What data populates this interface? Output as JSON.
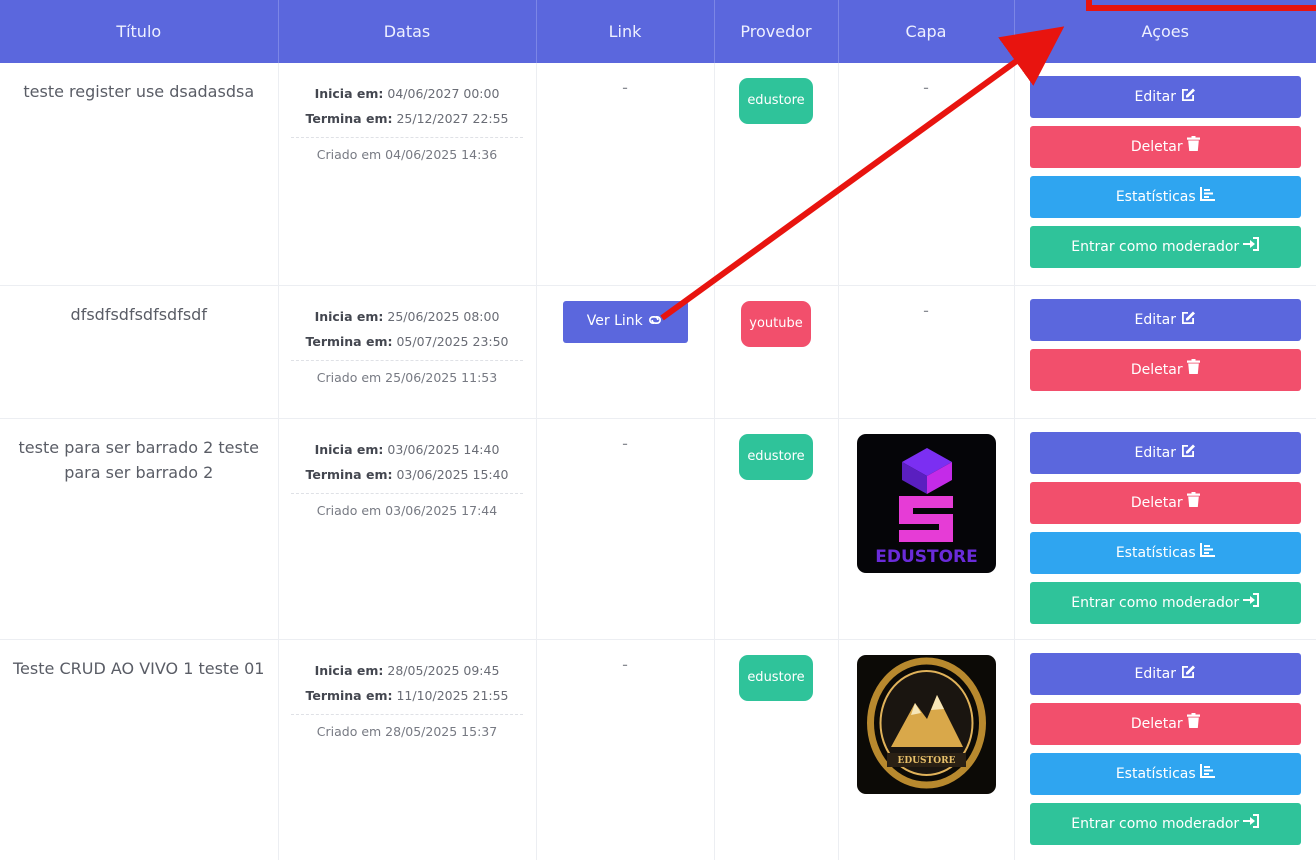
{
  "headers": [
    "Título",
    "Datas",
    "Link",
    "Provedor",
    "Capa",
    "Açoes"
  ],
  "labels": {
    "starts": "Inicia em:",
    "ends": "Termina em:",
    "dash": "-",
    "view_link": "Ver Link",
    "edit": "Editar",
    "delete": "Deletar",
    "stats": "Estatísticas",
    "moderator": "Entrar como moderador"
  },
  "rows": [
    {
      "title": "teste register use dsadasdsa",
      "starts": "04/06/2027 00:00",
      "ends": "25/12/2027 22:55",
      "created": "Criado em 04/06/2025 14:36",
      "provider": "edustore"
    },
    {
      "title": "dfsdfsdfsdfsdfsdf",
      "starts": "25/06/2025 08:00",
      "ends": "05/07/2025 23:50",
      "created": "Criado em 25/06/2025 11:53",
      "provider": "youtube"
    },
    {
      "title": "teste para ser barrado 2 teste para ser barrado 2",
      "starts": "03/06/2025 14:40",
      "ends": "03/06/2025 15:40",
      "created": "Criado em 03/06/2025 17:44",
      "provider": "edustore",
      "cover_text": "EDUSTORE"
    },
    {
      "title": "Teste CRUD AO VIVO 1 teste 01",
      "starts": "28/05/2025 09:45",
      "ends": "11/10/2025 21:55",
      "created": "Criado em 28/05/2025 15:37",
      "provider": "edustore",
      "cover_text": "EDUSTORE"
    }
  ],
  "colors": {
    "header": "#5b67dd",
    "edit": "#5b67dd",
    "delete": "#f24f6c",
    "stats": "#2fa5f0",
    "moderator": "#2fc39a",
    "annotation": "#e8140f"
  },
  "icons": {
    "edit": "pencil-square-icon",
    "delete": "trash-icon",
    "stats": "chart-bars-icon",
    "moderator": "enter-arrow-icon",
    "link": "link-icon"
  }
}
